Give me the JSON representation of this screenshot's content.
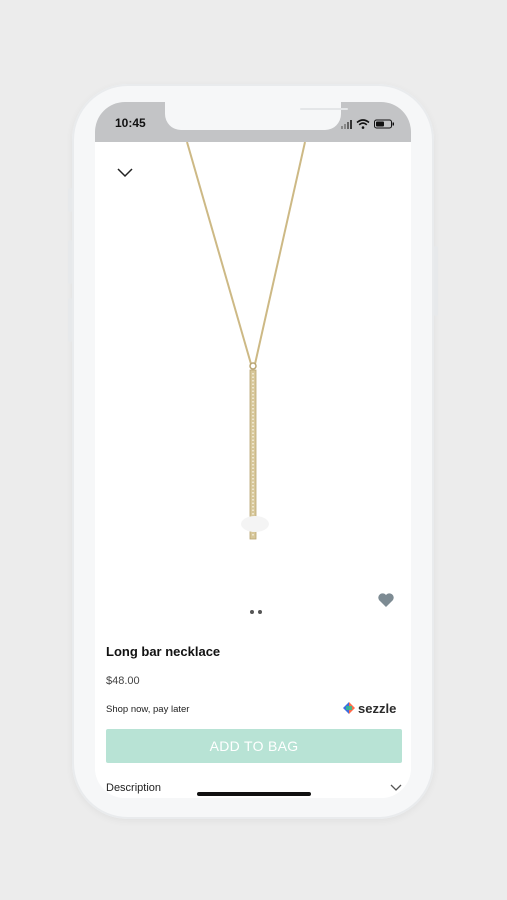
{
  "status_bar": {
    "time": "10:45"
  },
  "product": {
    "title": "Long bar necklace",
    "price": "$48.00",
    "image_count": 2
  },
  "payment": {
    "shop_later_text": "Shop now, pay later",
    "provider_name": "sezzle"
  },
  "actions": {
    "add_to_bag_label": "ADD TO BAG"
  },
  "details": {
    "description_label": "Description"
  },
  "icons": {
    "close": "chevron-down-icon",
    "favorite": "heart-icon",
    "expand": "chevron-down-icon",
    "signal": "signal-icon",
    "wifi": "wifi-icon",
    "battery": "battery-icon"
  },
  "colors": {
    "add_button_bg": "#b8e3d5",
    "heart": "#7d8b93",
    "status_bar_bg": "#c3c4c6",
    "necklace_gold": "#cdb985"
  }
}
